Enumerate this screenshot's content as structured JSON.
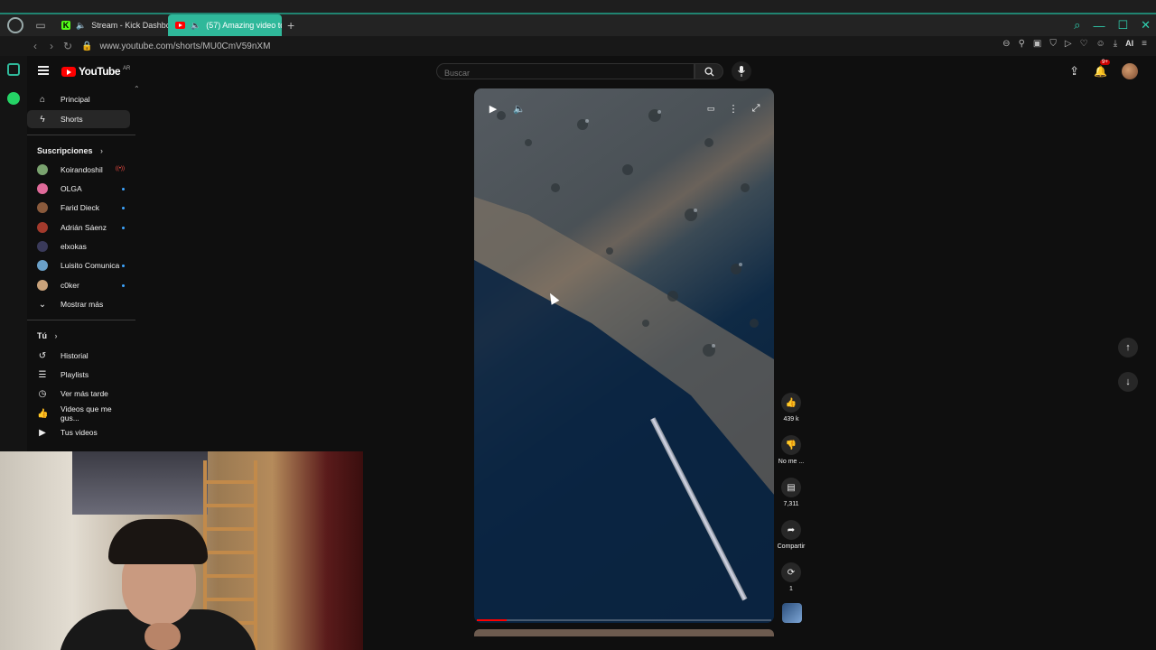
{
  "browser": {
    "tabs": [
      {
        "title": "Stream - Kick Dashboard",
        "active": false
      },
      {
        "title": "(57) Amazing video to",
        "active": true
      }
    ],
    "url": "www.youtube.com/shorts/MU0CmV59nXM",
    "ai_label": "AI"
  },
  "header": {
    "logo_text": "YouTube",
    "country_code": "AR",
    "search_placeholder": "Buscar",
    "notifications_badge": "9+"
  },
  "sidebar": {
    "main": [
      {
        "label": "Principal",
        "icon": "home-icon"
      },
      {
        "label": "Shorts",
        "icon": "shorts-icon",
        "active": true
      }
    ],
    "subscriptions_heading": "Suscripciones",
    "subscriptions": [
      {
        "label": "Koirandoshil",
        "color": "#7aa36f",
        "indicator": "live"
      },
      {
        "label": "OLGA",
        "color": "#e06a9a",
        "indicator": "dot"
      },
      {
        "label": "Farid Dieck",
        "color": "#8a5a3c",
        "indicator": "dot"
      },
      {
        "label": "Adrián Sáenz",
        "color": "#a33a2c",
        "indicator": "dot"
      },
      {
        "label": "elxokas",
        "color": "#3a3a5a",
        "indicator": ""
      },
      {
        "label": "Luisito Comunica",
        "color": "#6aa0c8",
        "indicator": "dot"
      },
      {
        "label": "c0ker",
        "color": "#c9a27a",
        "indicator": "dot"
      }
    ],
    "show_more": "Mostrar más",
    "you_heading": "Tú",
    "you": [
      {
        "label": "Historial",
        "icon": "history-icon"
      },
      {
        "label": "Playlists",
        "icon": "playlist-icon"
      },
      {
        "label": "Ver más tarde",
        "icon": "clock-icon"
      },
      {
        "label": "Videos que me gus...",
        "icon": "thumb-up-icon"
      },
      {
        "label": "Tus videos",
        "icon": "your-videos-icon"
      }
    ]
  },
  "short": {
    "progress_fraction": 0.1,
    "actions": {
      "likes": "439 k",
      "dislike": "No me ...",
      "comments": "7,311",
      "share": "Compartir",
      "remix": "1"
    }
  }
}
